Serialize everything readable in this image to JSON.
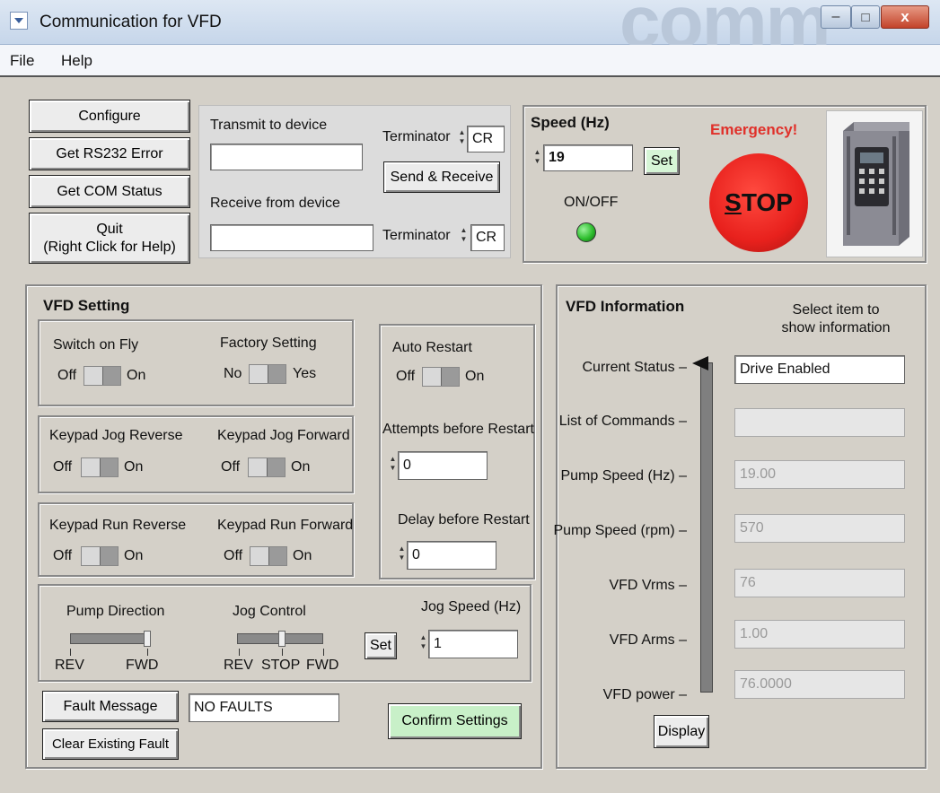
{
  "window": {
    "title": "Communication for VFD",
    "bg_logo_text": "comm",
    "controls": {
      "minimize": "–",
      "maximize": "□",
      "close": "x"
    }
  },
  "menu": [
    "File",
    "Help"
  ],
  "comm": {
    "configure": "Configure",
    "rs232_error": "Get RS232 Error",
    "com_status": "Get COM Status",
    "quit_line1": "Quit",
    "quit_line2": "(Right Click for Help)",
    "transmit_label": "Transmit to device",
    "transmit_value": "",
    "receive_label": "Receive from device",
    "receive_value": "",
    "terminator_label": "Terminator",
    "terminator_value": "CR",
    "send_receive": "Send & Receive"
  },
  "speed": {
    "title": "Speed (Hz)",
    "value": "19",
    "set": "Set",
    "onoff_label": "ON/OFF",
    "emergency": "Emergency!",
    "stop_s": "S",
    "stop_rest": "TOP"
  },
  "vfd_setting": {
    "title": "VFD Setting",
    "switch_on_fly": "Switch on Fly",
    "factory_setting": "Factory Setting",
    "keypad_jog_reverse": "Keypad Jog Reverse",
    "keypad_jog_forward": "Keypad Jog Forward",
    "keypad_run_reverse": "Keypad Run Reverse",
    "keypad_run_forward": "Keypad Run Forward",
    "off": "Off",
    "on": "On",
    "no": "No",
    "yes": "Yes",
    "auto_restart": "Auto Restart",
    "attempts_label": "Attempts before Restart",
    "attempts_value": "0",
    "delay_label": "Delay before Restart",
    "delay_value": "0",
    "pump_direction": "Pump Direction",
    "rev": "REV",
    "fwd": "FWD",
    "stop": "STOP",
    "jog_control": "Jog Control",
    "jog_speed_label": "Jog Speed (Hz)",
    "jog_speed_value": "1",
    "set": "Set",
    "fault_message": "Fault Message",
    "fault_value": "NO FAULTS",
    "clear_fault": "Clear Existing Fault",
    "confirm": "Confirm Settings"
  },
  "vfd_info": {
    "title": "VFD Information",
    "select_hint_line1": "Select item to",
    "select_hint_line2": "show information",
    "items": [
      {
        "label": "Current Status",
        "value": "Drive Enabled"
      },
      {
        "label": "List of Commands",
        "value": ""
      },
      {
        "label": "Pump Speed (Hz)",
        "value": "19.00"
      },
      {
        "label": "Pump Speed (rpm)",
        "value": "570"
      },
      {
        "label": "VFD Vrms",
        "value": "76"
      },
      {
        "label": "VFD Arms",
        "value": "1.00"
      },
      {
        "label": "VFD power",
        "value": "76.0000"
      }
    ],
    "display": "Display"
  },
  "colors": {
    "stop_red": "#e8211d",
    "emergency_red": "#e0302a",
    "led_green": "#2fbf2f",
    "confirm_green": "#c8f0c8",
    "set_green": "#d6f5d6"
  }
}
